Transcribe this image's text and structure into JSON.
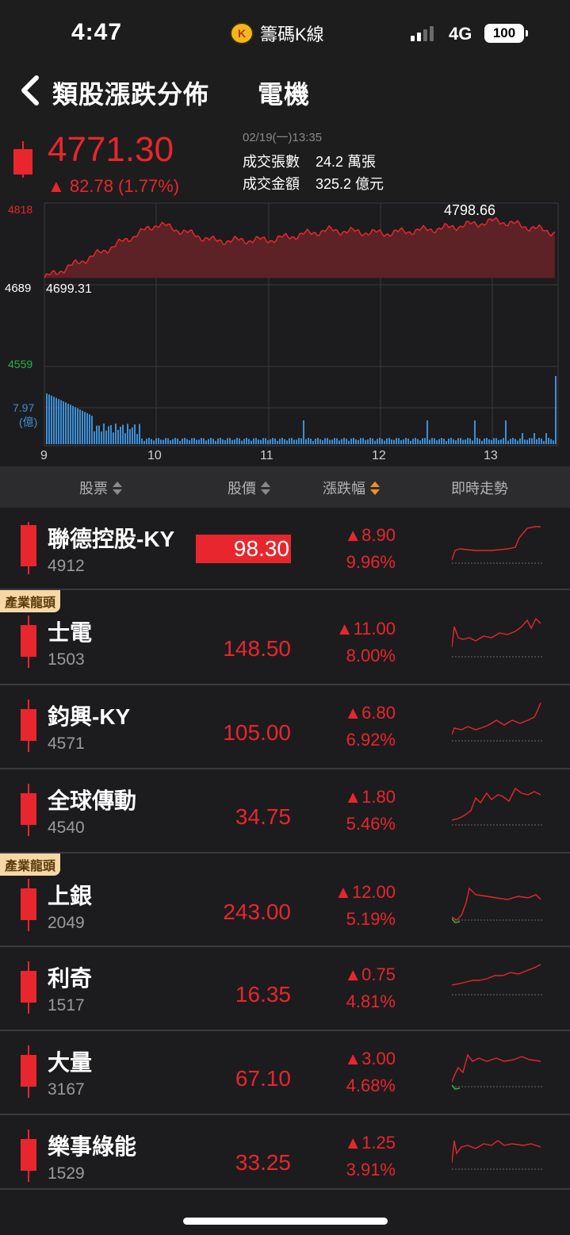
{
  "status": {
    "time": "4:47",
    "app_name": "籌碼K線",
    "app_logo": "K",
    "network": "4G",
    "battery": "100"
  },
  "nav": {
    "title": "類股漲跌分佈",
    "sector": "電機"
  },
  "quote": {
    "price": "4771.30",
    "change": "▲ 82.78 (1.77%)",
    "date": "02/19(一)13:35",
    "volume_label": "成交張數",
    "volume_value": "24.2 萬張",
    "amount_label": "成交金額",
    "amount_value": "325.2 億元",
    "colors": {
      "up": "#e8262d",
      "down": "#2ab24a",
      "volume": "#3d8fd6"
    }
  },
  "chart": {
    "y_high": "4818",
    "y_mid": "4689",
    "y_low": "4559",
    "ref_price": "4699.31",
    "peak_label": "4798.66",
    "vol_label": "7.97",
    "vol_unit": "(億)",
    "x_ticks": [
      "9",
      "10",
      "11",
      "12",
      "13"
    ]
  },
  "chart_data": {
    "type": "line",
    "title": "",
    "xlabel": "",
    "ylabel": "",
    "x": [
      "9:00",
      "9:30",
      "10:00",
      "10:30",
      "11:00",
      "11:30",
      "12:00",
      "12:30",
      "13:00",
      "13:30"
    ],
    "series": [
      {
        "name": "",
        "values": [
          4699.31,
          4740,
          4785,
          4758,
          4760,
          4775,
          4770,
          4778,
          4790,
          4771.3
        ]
      }
    ],
    "ylim": [
      4559,
      4818
    ],
    "reference": 4699.31,
    "peak": 4798.66,
    "grid": true
  },
  "table": {
    "headers": {
      "stock": "股票",
      "price": "股價",
      "change": "漲跌幅",
      "trend": "即時走勢"
    },
    "rows": [
      {
        "name": "聯德控股-KY",
        "code": "4912",
        "price": "98.30",
        "change": "▲8.90",
        "pct": "9.96%",
        "tag": "",
        "highlight": true
      },
      {
        "name": "士電",
        "code": "1503",
        "price": "148.50",
        "change": "▲11.00",
        "pct": "8.00%",
        "tag": "產業龍頭",
        "highlight": false
      },
      {
        "name": "鈞興-KY",
        "code": "4571",
        "price": "105.00",
        "change": "▲6.80",
        "pct": "6.92%",
        "tag": "",
        "highlight": false
      },
      {
        "name": "全球傳動",
        "code": "4540",
        "price": "34.75",
        "change": "▲1.80",
        "pct": "5.46%",
        "tag": "",
        "highlight": false
      },
      {
        "name": "上銀",
        "code": "2049",
        "price": "243.00",
        "change": "▲12.00",
        "pct": "5.19%",
        "tag": "產業龍頭",
        "highlight": false
      },
      {
        "name": "利奇",
        "code": "1517",
        "price": "16.35",
        "change": "▲0.75",
        "pct": "4.81%",
        "tag": "",
        "highlight": false
      },
      {
        "name": "大量",
        "code": "3167",
        "price": "67.10",
        "change": "▲3.00",
        "pct": "4.68%",
        "tag": "",
        "highlight": false
      },
      {
        "name": "樂事綠能",
        "code": "1529",
        "price": "33.25",
        "change": "▲1.25",
        "pct": "3.91%",
        "tag": "",
        "highlight": false
      }
    ]
  }
}
